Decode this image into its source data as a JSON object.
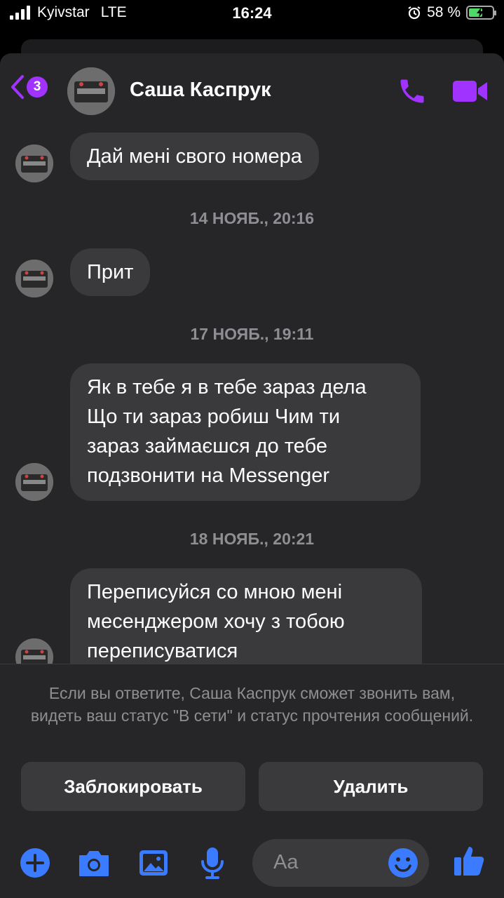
{
  "status_bar": {
    "carrier": "Kyivstar",
    "network": "LTE",
    "time": "16:24",
    "battery_percent": "58 %",
    "battery_level": 0.58
  },
  "header": {
    "unread_count": "3",
    "contact_name": "Саша Каспрук"
  },
  "chat": {
    "messages": [
      {
        "text": "Дай мені свого номера"
      },
      {
        "timestamp": "14 НОЯБ., 20:16"
      },
      {
        "text": "Прит"
      },
      {
        "timestamp": "17 НОЯБ., 19:11"
      },
      {
        "text": "Як в тебе я в тебе зараз дела\nЩо ти зараз робиш Чим ти\nзараз займаєшся до тебе\nподзвонити на Messenger"
      },
      {
        "timestamp": "18 НОЯБ., 20:21"
      },
      {
        "text": "Переписуйся со мною мені\nмесенджером хочу з тобою\nпереписуватися"
      }
    ]
  },
  "notice": "Если вы ответите, Саша Каспрук сможет звонить вам, видеть ваш статус \"В сети\" и статус прочтения сообщений.",
  "actions": {
    "block_label": "Заблокировать",
    "delete_label": "Удалить"
  },
  "composer": {
    "placeholder": "Aa"
  },
  "colors": {
    "accent": "#a033ff",
    "composer_blue": "#3b7bff",
    "bubble": "#3a3a3c",
    "sheet": "#262628"
  }
}
